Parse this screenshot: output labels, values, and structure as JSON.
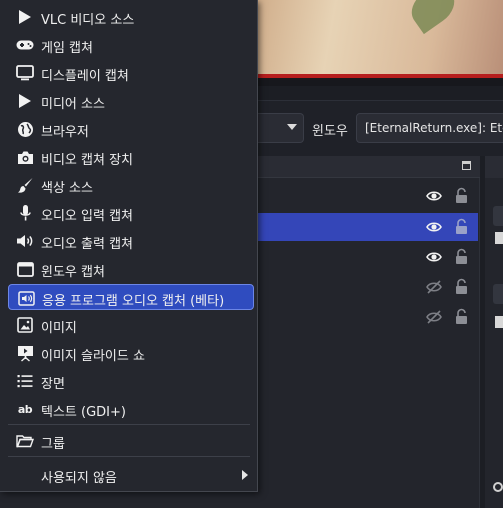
{
  "window_selector": {
    "label": "윈도우",
    "value": "[EternalReturn.exe]: Ete"
  },
  "context_menu": {
    "items": [
      {
        "label": "VLC 비디오 소스",
        "icon": "play-icon"
      },
      {
        "label": "게임 캡쳐",
        "icon": "gamepad-icon"
      },
      {
        "label": "디스플레이 캡쳐",
        "icon": "monitor-icon"
      },
      {
        "label": "미디어 소스",
        "icon": "play-icon"
      },
      {
        "label": "브라우저",
        "icon": "globe-icon"
      },
      {
        "label": "비디오 캡쳐 장치",
        "icon": "camera-icon"
      },
      {
        "label": "색상 소스",
        "icon": "brush-icon"
      },
      {
        "label": "오디오 입력 캡쳐",
        "icon": "microphone-icon"
      },
      {
        "label": "오디오 출력 캡쳐",
        "icon": "speaker-icon"
      },
      {
        "label": "윈도우 캡쳐",
        "icon": "window-icon"
      },
      {
        "label": "응용 프로그램 오디오 캡처 (베타)",
        "icon": "app-audio-icon",
        "highlighted": true
      },
      {
        "label": "이미지",
        "icon": "image-icon"
      },
      {
        "label": "이미지 슬라이드 쇼",
        "icon": "slideshow-icon"
      },
      {
        "label": "장면",
        "icon": "list-icon"
      },
      {
        "label": "텍스트 (GDI+)",
        "icon": "text-icon",
        "glyph": "ab"
      },
      {
        "label": "그룹",
        "icon": "folder-icon"
      },
      {
        "label": "사용되지 않음",
        "icon": "none",
        "submenu": true
      }
    ]
  },
  "sources_rows": [
    {
      "visible": true,
      "locked": false,
      "selected": false
    },
    {
      "visible": true,
      "locked": false,
      "selected": true
    },
    {
      "visible": true,
      "locked": false,
      "selected": false
    },
    {
      "visible": false,
      "locked": false,
      "selected": false
    },
    {
      "visible": false,
      "locked": false,
      "selected": false
    }
  ],
  "colors": {
    "accent": "#2f4cbf",
    "selection": "#3446b8",
    "menu_bg": "#25272e",
    "app_bg": "#1c1e24"
  }
}
